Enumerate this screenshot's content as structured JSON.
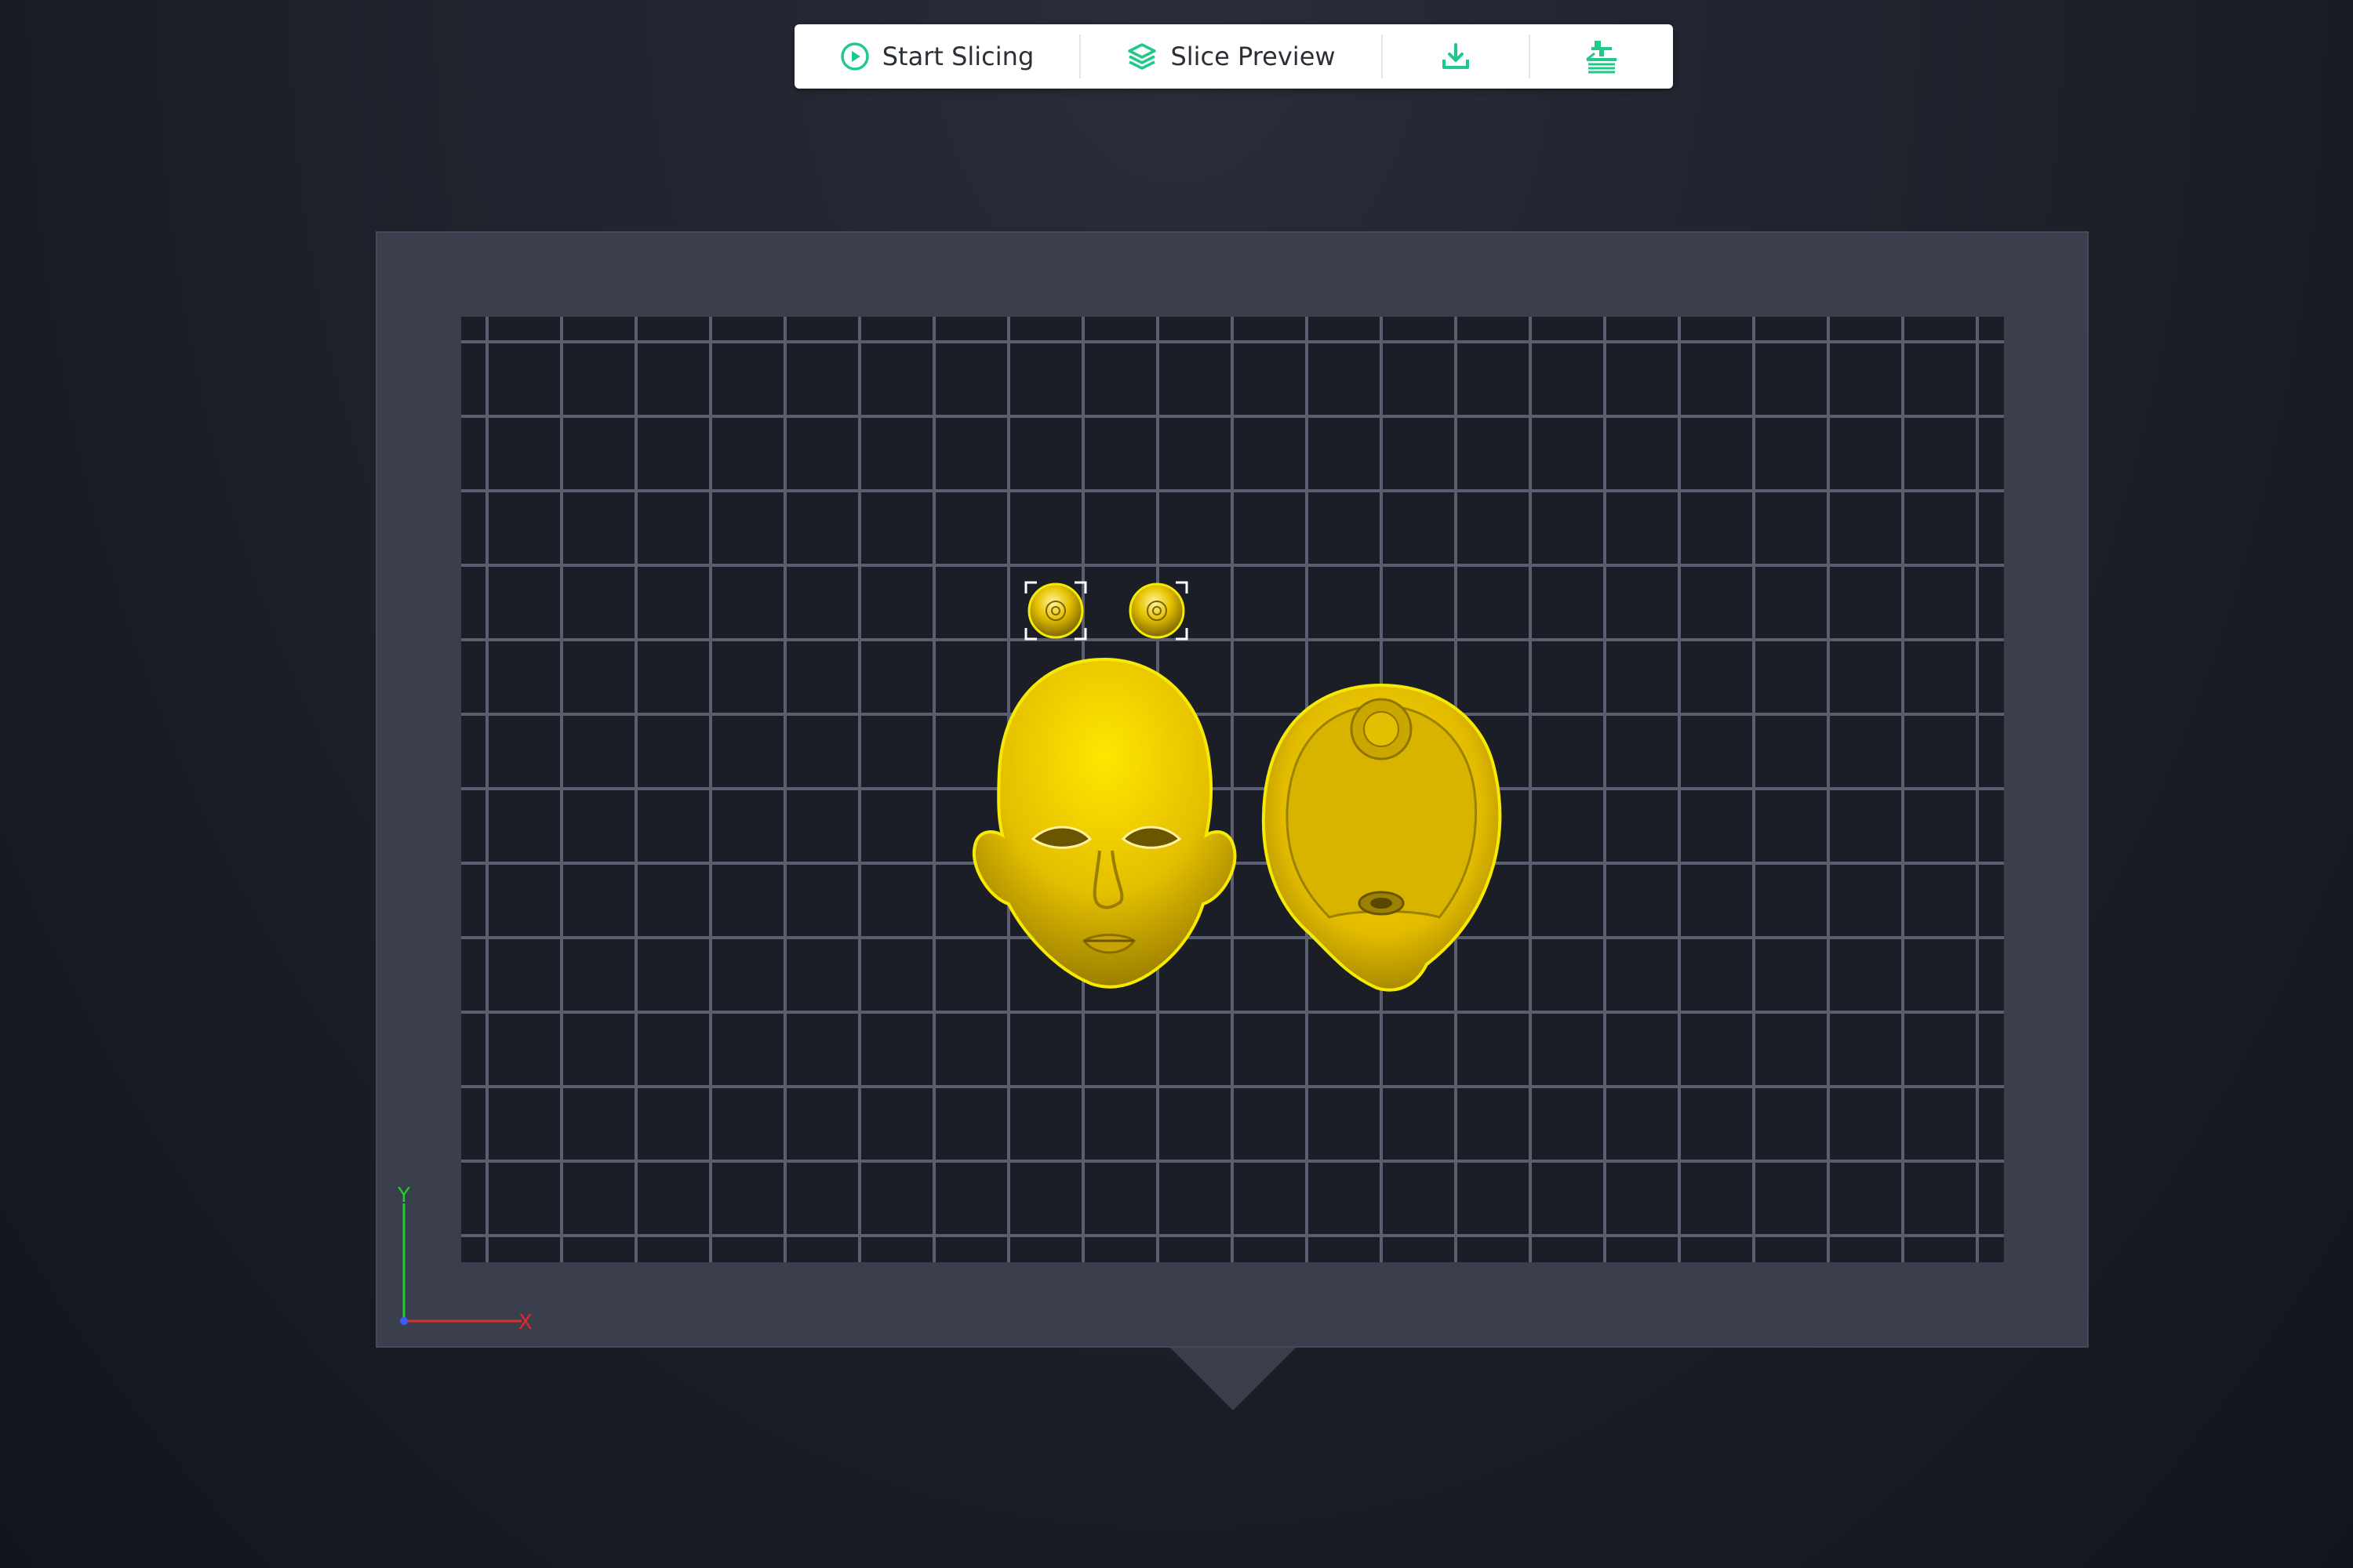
{
  "toolbar": {
    "start_slicing_label": "Start Slicing",
    "slice_preview_label": "Slice Preview",
    "download_icon": "download-icon",
    "print_icon": "printer-upload-icon"
  },
  "accent_color": "#1fc98a",
  "model_color": "#f2d800",
  "axes": {
    "x_label": "X",
    "y_label": "Y"
  },
  "models": [
    "eye-left",
    "eye-right",
    "head-face",
    "head-back-shell"
  ]
}
